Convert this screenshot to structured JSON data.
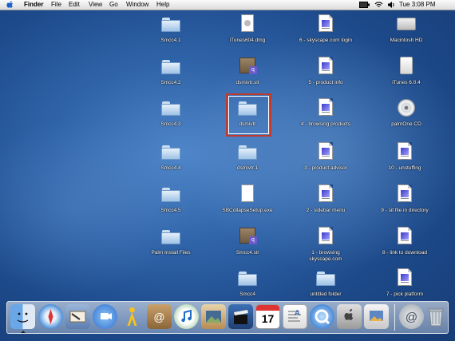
{
  "menubar": {
    "apple": "",
    "app_name": "Finder",
    "menus": [
      "File",
      "Edit",
      "View",
      "Go",
      "Window",
      "Help"
    ],
    "clock": "Tue 3:08 PM"
  },
  "desktop": {
    "col1": [
      "Smcc4.1",
      "Smcc4.2",
      "Smcc4.3",
      "Smcc4.4",
      "Smcc4.5",
      "Palm Install Files"
    ],
    "col2": [
      "iTunes604.dmg",
      "dsmivtr.sit",
      "dsmivtr",
      "dsmivtr.1",
      "SBCollapseSetup.exe",
      "Smcc4.sit",
      "Smcc4"
    ],
    "col3": [
      "6 - skyscape.com login",
      "5 - product info",
      "4 - browsing products",
      "3 - product advisor",
      "2 - sidebar menu",
      "1 - browsing skyscape.com",
      "untitled folder"
    ],
    "col4": [
      "Macintosh HD",
      "iTunes 6.0.4",
      "palmOne CD",
      "10 - unstuffing",
      "9 - sit file in directory",
      "8 - link to download",
      "7 - pick platform"
    ]
  },
  "dock": {
    "items": [
      "finder-icon",
      "safari-icon",
      "mail-icon",
      "ichat-icon",
      "aim-icon",
      "address-book-icon",
      "itunes-icon",
      "iphoto-icon",
      "imovie-icon",
      "ical-icon",
      "textedit-icon",
      "quicktime-icon",
      "system-preferences-icon",
      "preview-icon",
      "sherlock-icon",
      "trash-icon"
    ],
    "calendar_day": "17"
  }
}
